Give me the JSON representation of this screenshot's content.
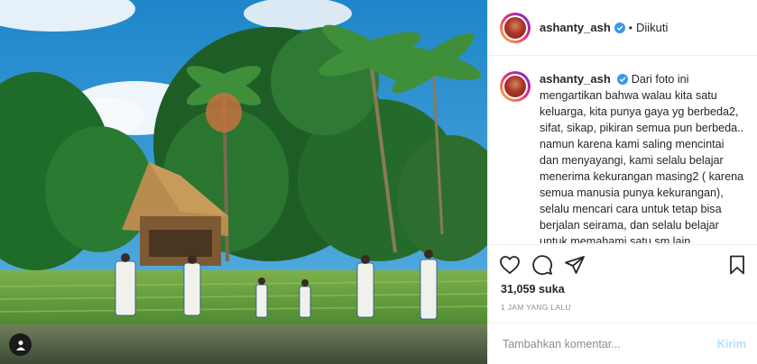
{
  "post": {
    "username": "ashanty_ash",
    "follow_status": "Diikuti",
    "separator": "•",
    "caption": "Dari foto ini mengartikan bahwa walau kita satu keluarga, kita punya gaya yg berbeda2, sifat, sikap, pikiran semua pun berbeda.. namun karena kami saling mencintai dan menyayangi, kami selalu belajar menerima kekurangan masing2 ( karena semua manusia punya kekurangan), selalu mencari cara untuk tetap bisa berjalan seirama, dan selalu belajar untuk memahami satu sm lain",
    "likes": "31,059 suka",
    "timestamp": "1 JAM YANG LALU",
    "comment_placeholder": "Tambahkan komentar...",
    "post_button": "Kirim"
  },
  "icons": {
    "verified": "verified-badge-icon",
    "like": "heart-icon",
    "comment": "comment-bubble-icon",
    "share": "paper-plane-icon",
    "save": "bookmark-icon",
    "tag": "user-tag-icon"
  },
  "colors": {
    "verified": "#3897f0",
    "post_button": "#b2dffc",
    "muted": "#8e8e8e",
    "text": "#262626"
  }
}
